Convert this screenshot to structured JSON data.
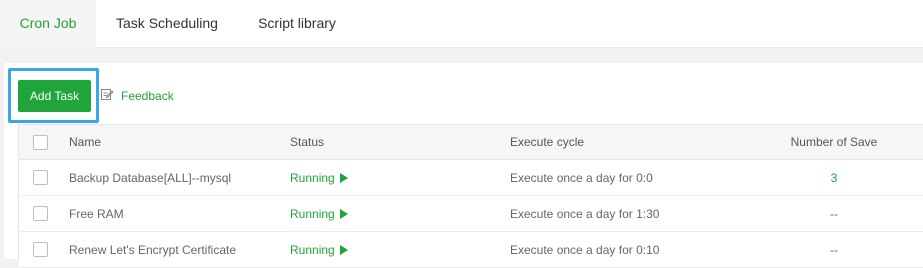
{
  "tabs": [
    {
      "label": "Cron Job",
      "active": true
    },
    {
      "label": "Task Scheduling",
      "active": false
    },
    {
      "label": "Script library",
      "active": false
    }
  ],
  "toolbar": {
    "add_task_label": "Add Task",
    "feedback_label": "Feedback",
    "feedback_icon": "edit-note-icon"
  },
  "table": {
    "headers": {
      "name": "Name",
      "status": "Status",
      "execute_cycle": "Execute cycle",
      "number_of_save": "Number of Save"
    },
    "rows": [
      {
        "name": "Backup Database[ALL]--mysql",
        "status": "Running",
        "cycle": "Execute once a day for 0:0",
        "save": "3"
      },
      {
        "name": "Free RAM",
        "status": "Running",
        "cycle": "Execute once a day for 1:30",
        "save": "--"
      },
      {
        "name": "Renew Let's Encrypt Certificate",
        "status": "Running",
        "cycle": "Execute once a day for 0:10",
        "save": "--"
      }
    ]
  },
  "colors": {
    "accent": "#20a53a",
    "highlight_border": "#3aa8e6"
  }
}
